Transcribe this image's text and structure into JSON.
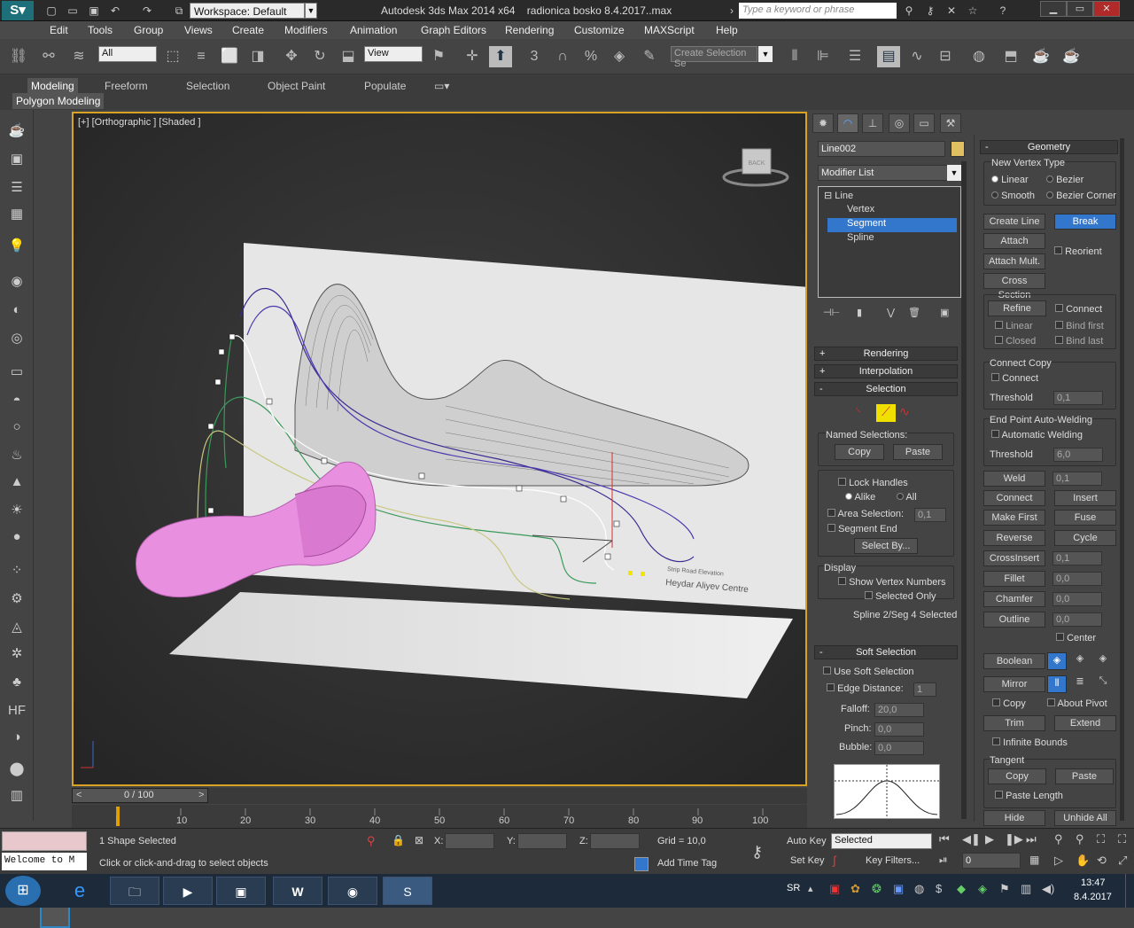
{
  "titlebar": {
    "workspace": "Workspace: Default",
    "title": "Autodesk 3ds Max  2014 x64",
    "file": "radionica bosko 8.4.2017..max",
    "search_placeholder": "Type a keyword or phrase"
  },
  "menu": [
    "Edit",
    "Tools",
    "Group",
    "Views",
    "Create",
    "Modifiers",
    "Animation",
    "Graph Editors",
    "Rendering",
    "Customize",
    "MAXScript",
    "Help"
  ],
  "toolbar": {
    "filter": "All",
    "refcoord": "View",
    "selection_set": "Create Selection Se"
  },
  "ribbon": {
    "tabs": [
      "Modeling",
      "Freeform",
      "Selection",
      "Object Paint",
      "Populate"
    ],
    "active": "Modeling",
    "sub": "Polygon Modeling"
  },
  "viewport": {
    "label": "[+] [Orthographic ] [Shaded ]",
    "viewcube": "BACK",
    "sign1": "Heydar Aliyev Centre",
    "sign2": "Strip Road Elevation"
  },
  "timeline": {
    "frame": "0 / 100",
    "ticks": [
      "10",
      "20",
      "30",
      "40",
      "50",
      "60",
      "70",
      "80",
      "90",
      "100"
    ]
  },
  "panel": {
    "object_name": "Line002",
    "modifier_list": "Modifier List",
    "stack": [
      "Line",
      "Vertex",
      "Segment",
      "Spline"
    ],
    "stack_selected": "Segment",
    "rollouts": {
      "rendering": "Rendering",
      "interpolation": "Interpolation",
      "selection": "Selection",
      "soft_selection": "Soft Selection"
    },
    "named_selections": "Named Selections:",
    "copy": "Copy",
    "paste": "Paste",
    "lock_handles": "Lock Handles",
    "alike": "Alike",
    "all": "All",
    "area_selection": "Area Selection:",
    "area_value": "0,1",
    "segment_end": "Segment End",
    "select_by": "Select By...",
    "display": "Display",
    "show_vertex_numbers": "Show Vertex Numbers",
    "selected_only": "Selected Only",
    "status": "Spline 2/Seg 4 Selected",
    "use_soft": "Use Soft Selection",
    "edge_distance": "Edge Distance:",
    "edge_value": "1",
    "falloff": "Falloff:",
    "falloff_value": "20,0",
    "pinch": "Pinch:",
    "pinch_value": "0,0",
    "bubble": "Bubble:",
    "bubble_value": "0,0"
  },
  "geometry": {
    "title": "Geometry",
    "new_vertex_type": "New Vertex Type",
    "linear": "Linear",
    "bezier": "Bezier",
    "smooth": "Smooth",
    "bezier_corner": "Bezier Corner",
    "create_line": "Create Line",
    "break": "Break",
    "attach": "Attach",
    "reorient": "Reorient",
    "attach_mult": "Attach Mult.",
    "cross_section": "Cross Section",
    "refine": "Refine",
    "connect": "Connect",
    "linear2": "Linear",
    "bind_first": "Bind first",
    "closed": "Closed",
    "bind_last": "Bind last",
    "connect_copy": "Connect Copy",
    "connect2": "Connect",
    "threshold": "Threshold",
    "threshold1": "0,1",
    "end_point": "End Point Auto-Welding",
    "automatic_welding": "Automatic Welding",
    "threshold2": "6,0",
    "weld": "Weld",
    "weld_value": "0,1",
    "connect3": "Connect",
    "insert": "Insert",
    "make_first": "Make First",
    "fuse": "Fuse",
    "reverse": "Reverse",
    "cycle": "Cycle",
    "crossinsert": "CrossInsert",
    "crossinsert_value": "0,1",
    "fillet": "Fillet",
    "fillet_value": "0,0",
    "chamfer": "Chamfer",
    "chamfer_value": "0,0",
    "outline": "Outline",
    "outline_value": "0,0",
    "center": "Center",
    "boolean": "Boolean",
    "mirror": "Mirror",
    "copy": "Copy",
    "about_pivot": "About Pivot",
    "trim": "Trim",
    "extend": "Extend",
    "infinite_bounds": "Infinite Bounds",
    "tangent": "Tangent",
    "t_copy": "Copy",
    "t_paste": "Paste",
    "paste_length": "Paste Length",
    "hide": "Hide",
    "unhide_all": "Unhide All"
  },
  "status": {
    "listener": "Welcome to M",
    "selected": "1 Shape Selected",
    "prompt": "Click or click-and-drag to select objects",
    "x": "X:",
    "y": "Y:",
    "z": "Z:",
    "grid": "Grid = 10,0",
    "add_time_tag": "Add Time Tag",
    "auto_key": "Auto Key",
    "set_key": "Set Key",
    "key_mode": "Selected",
    "key_filters": "Key Filters...",
    "frame": "0"
  },
  "taskbar": {
    "lang": "SR",
    "time": "13:47",
    "date": "8.4.2017"
  }
}
